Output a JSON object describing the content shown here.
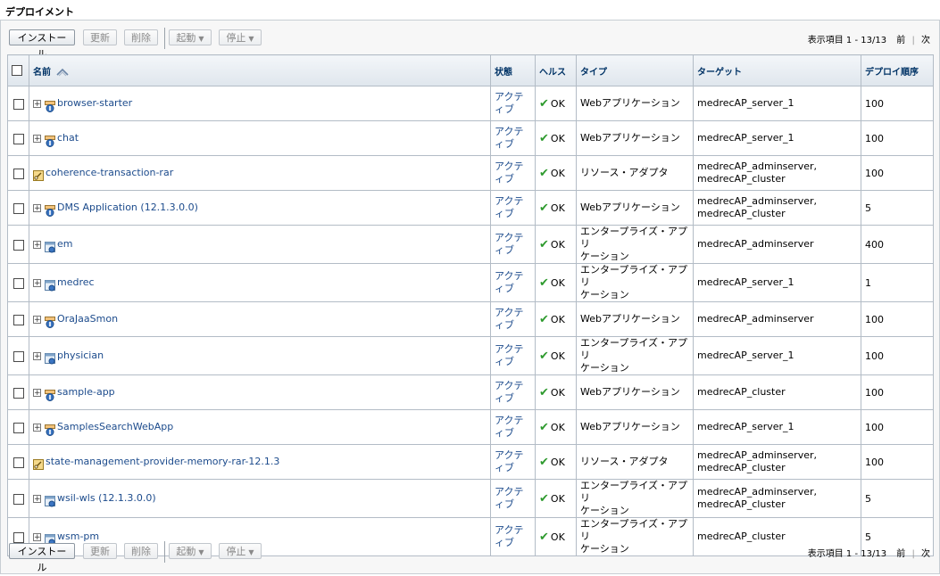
{
  "page": {
    "title": "デプロイメント"
  },
  "toolbar": {
    "install": "インストール",
    "update": "更新",
    "delete": "削除",
    "start": "起動",
    "stop": "停止",
    "pager_text": "表示項目 1 - 13/13",
    "prev": "前",
    "next": "次"
  },
  "columns": {
    "name": "名前",
    "state": "状態",
    "health": "ヘルス",
    "type": "タイプ",
    "target": "ターゲット",
    "order": "デプロイ順序"
  },
  "rows": [
    {
      "name": "browser-starter",
      "state": "アクティブ",
      "health": "OK",
      "type": "Webアプリケーション",
      "target": "medrecAP_server_1",
      "order": "100",
      "icon": "web-app-icon",
      "expandable": true
    },
    {
      "name": "chat",
      "state": "アクティブ",
      "health": "OK",
      "type": "Webアプリケーション",
      "target": "medrecAP_server_1",
      "order": "100",
      "icon": "web-app-icon",
      "expandable": true
    },
    {
      "name": "coherence-transaction-rar",
      "state": "アクティブ",
      "health": "OK",
      "type": "リソース・アダプタ",
      "target": "medrecAP_adminserver,\nmedrecAP_cluster",
      "order": "100",
      "icon": "resource-adapter-icon",
      "expandable": false
    },
    {
      "name": "DMS Application (12.1.3.0.0)",
      "state": "アクティブ",
      "health": "OK",
      "type": "Webアプリケーション",
      "target": "medrecAP_adminserver,\nmedrecAP_cluster",
      "order": "5",
      "icon": "web-app-icon",
      "expandable": true
    },
    {
      "name": "em",
      "state": "アクティブ",
      "health": "OK",
      "type": "エンタープライズ・アプリ\nケーション",
      "target": "medrecAP_adminserver",
      "order": "400",
      "icon": "enterprise-app-icon",
      "expandable": true
    },
    {
      "name": "medrec",
      "state": "アクティブ",
      "health": "OK",
      "type": "エンタープライズ・アプリ\nケーション",
      "target": "medrecAP_server_1",
      "order": "1",
      "icon": "enterprise-app-icon",
      "expandable": true
    },
    {
      "name": "OraJaaSmon",
      "state": "アクティブ",
      "health": "OK",
      "type": "Webアプリケーション",
      "target": "medrecAP_adminserver",
      "order": "100",
      "icon": "web-app-icon",
      "expandable": true
    },
    {
      "name": "physician",
      "state": "アクティブ",
      "health": "OK",
      "type": "エンタープライズ・アプリ\nケーション",
      "target": "medrecAP_server_1",
      "order": "100",
      "icon": "enterprise-app-icon",
      "expandable": true
    },
    {
      "name": "sample-app",
      "state": "アクティブ",
      "health": "OK",
      "type": "Webアプリケーション",
      "target": "medrecAP_cluster",
      "order": "100",
      "icon": "web-app-icon",
      "expandable": true
    },
    {
      "name": "SamplesSearchWebApp",
      "state": "アクティブ",
      "health": "OK",
      "type": "Webアプリケーション",
      "target": "medrecAP_server_1",
      "order": "100",
      "icon": "web-app-icon",
      "expandable": true
    },
    {
      "name": "state-management-provider-memory-rar-12.1.3",
      "state": "アクティブ",
      "health": "OK",
      "type": "リソース・アダプタ",
      "target": "medrecAP_adminserver,\nmedrecAP_cluster",
      "order": "100",
      "icon": "resource-adapter-icon",
      "expandable": false
    },
    {
      "name": "wsil-wls (12.1.3.0.0)",
      "state": "アクティブ",
      "health": "OK",
      "type": "エンタープライズ・アプリ\nケーション",
      "target": "medrecAP_adminserver,\nmedrecAP_cluster",
      "order": "5",
      "icon": "enterprise-app-icon",
      "expandable": true
    },
    {
      "name": "wsm-pm",
      "state": "アクティブ",
      "health": "OK",
      "type": "エンタープライズ・アプリ\nケーション",
      "target": "medrecAP_cluster",
      "order": "5",
      "icon": "enterprise-app-icon",
      "expandable": true
    }
  ],
  "colors": {
    "link": "#1c4b8c",
    "header_text": "#003366",
    "ok_check": "#2e9a2e"
  }
}
